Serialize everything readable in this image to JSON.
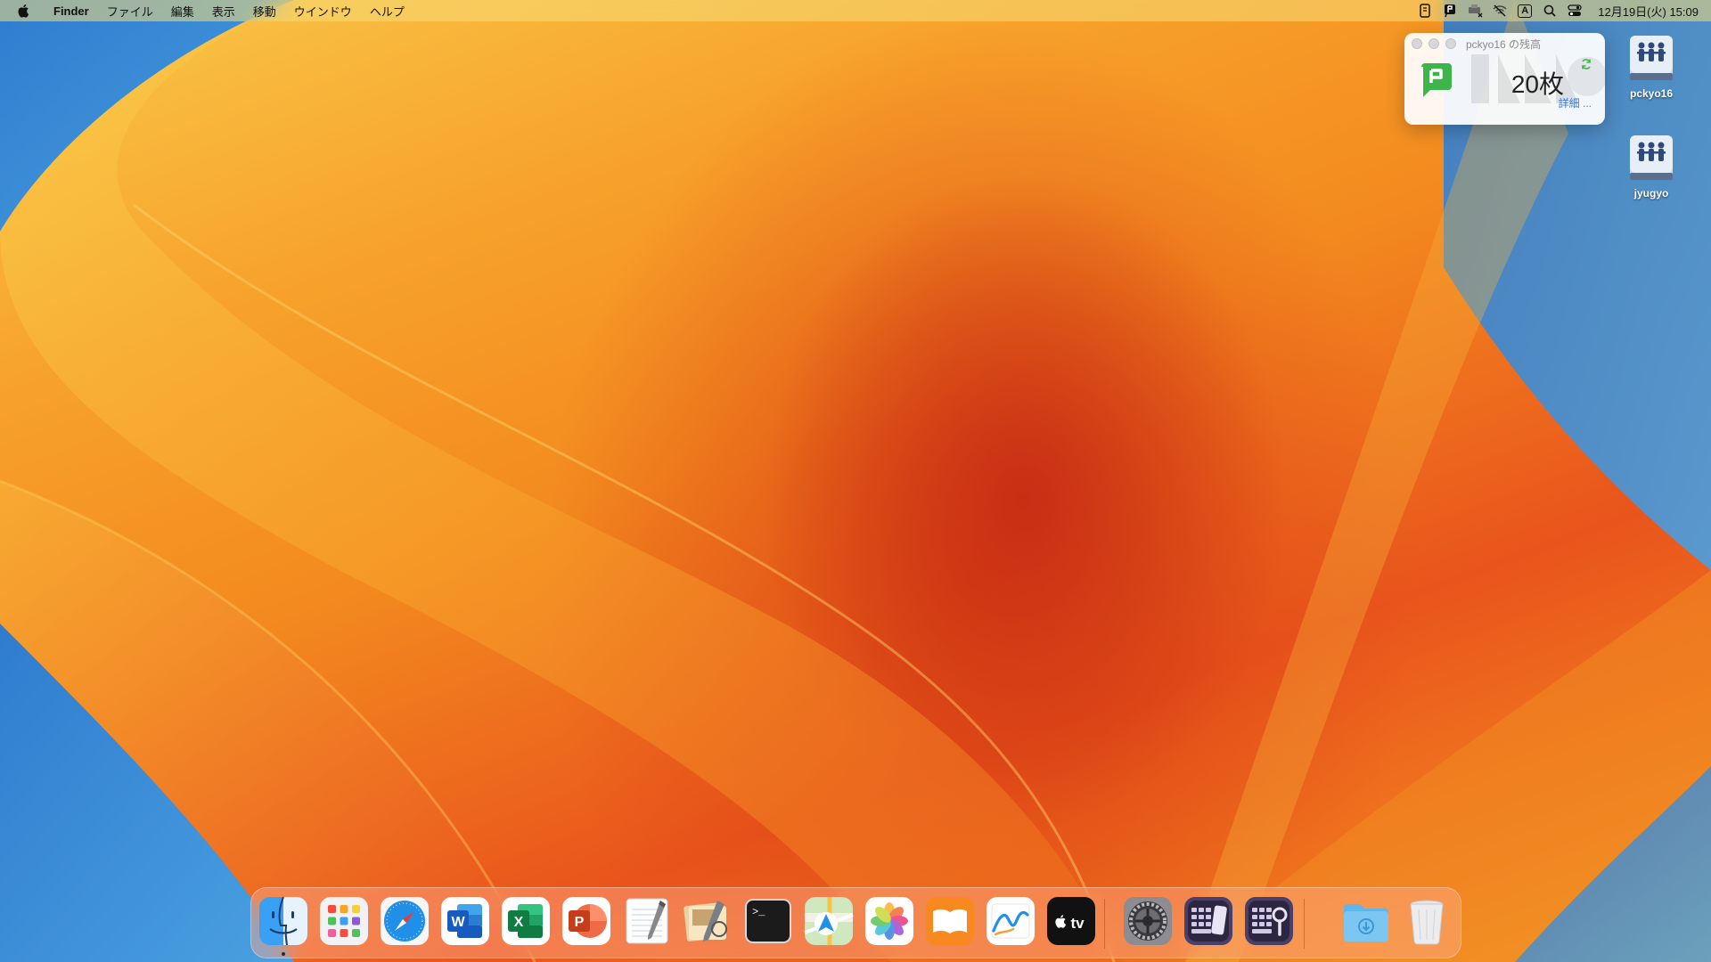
{
  "menubar": {
    "apple_icon": "apple-logo",
    "app_name": "Finder",
    "menus": [
      "ファイル",
      "編集",
      "表示",
      "移動",
      "ウインドウ",
      "ヘルプ"
    ],
    "status_icons": [
      "document-icon",
      "flag-icon",
      "printer-disconnected-icon",
      "wifi-off-icon",
      "input-method-icon",
      "search-icon",
      "control-center-icon"
    ],
    "input_method_label": "A",
    "clock": "12月19日(火)  15:09"
  },
  "widget": {
    "title": "pckyo16 の残高",
    "count": "20枚",
    "details": "詳細 ...",
    "accent_color": "#3db54a"
  },
  "desktop_icons": [
    {
      "label": "pckyo16",
      "icon": "network-volume-icon"
    },
    {
      "label": "jyugyo",
      "icon": "network-volume-icon"
    }
  ],
  "dock": {
    "apps": [
      {
        "name": "finder",
        "icon": "finder-icon"
      },
      {
        "name": "launchpad",
        "icon": "launchpad-icon"
      },
      {
        "name": "safari",
        "icon": "safari-icon"
      },
      {
        "name": "word",
        "icon": "word-icon",
        "letter": "W"
      },
      {
        "name": "excel",
        "icon": "excel-icon",
        "letter": "X"
      },
      {
        "name": "powerpoint",
        "icon": "powerpoint-icon",
        "letter": "P"
      },
      {
        "name": "textedit",
        "icon": "textedit-icon"
      },
      {
        "name": "preview",
        "icon": "preview-icon"
      },
      {
        "name": "terminal",
        "icon": "terminal-icon",
        "prompt": ">_"
      },
      {
        "name": "maps",
        "icon": "maps-icon"
      },
      {
        "name": "photos",
        "icon": "photos-icon"
      },
      {
        "name": "books",
        "icon": "books-icon"
      },
      {
        "name": "freeform",
        "icon": "freeform-icon"
      },
      {
        "name": "appletv",
        "icon": "apple-tv-icon",
        "label": "tv"
      },
      {
        "name": "system-settings",
        "icon": "system-settings-icon"
      },
      {
        "name": "keyboard-app-1",
        "icon": "keyboard-phone-icon"
      },
      {
        "name": "keyboard-app-2",
        "icon": "keyboard-search-icon"
      },
      {
        "name": "downloads",
        "icon": "downloads-folder-icon"
      },
      {
        "name": "trash",
        "icon": "trash-icon"
      }
    ]
  }
}
